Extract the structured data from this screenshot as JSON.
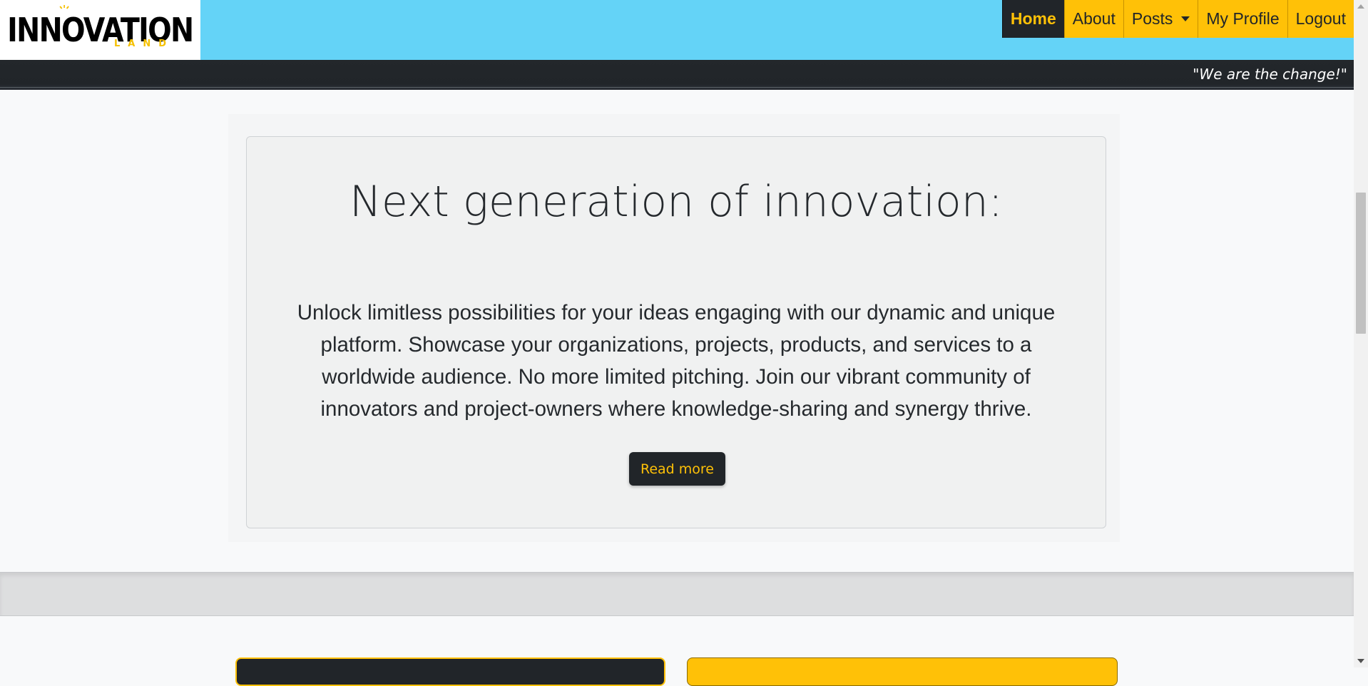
{
  "logo": {
    "word": "INNOVATION",
    "sub": "LAND"
  },
  "nav": {
    "items": [
      {
        "label": "Home",
        "active": true
      },
      {
        "label": "About"
      },
      {
        "label": "Posts",
        "dropdown": true
      },
      {
        "label": "My Profile"
      },
      {
        "label": "Logout"
      }
    ]
  },
  "tagline": "\"We are the change!\"",
  "hero": {
    "title": "Next generation of innovation:",
    "text": "Unlock limitless possibilities for your ideas engaging with our dynamic and unique platform. Showcase your organizations, projects, products, and services to a worldwide audience. No more limited pitching. Join our vibrant community of innovators and project-owners where knowledge-sharing and synergy thrive.",
    "button": "Read more"
  },
  "colors": {
    "brand_yellow": "#ffc107",
    "brand_dark": "#212529",
    "header_sky": "#64d3f7"
  },
  "icons": {
    "logo_bulb": "lightbulb-icon",
    "posts_caret": "caret-down-icon"
  }
}
